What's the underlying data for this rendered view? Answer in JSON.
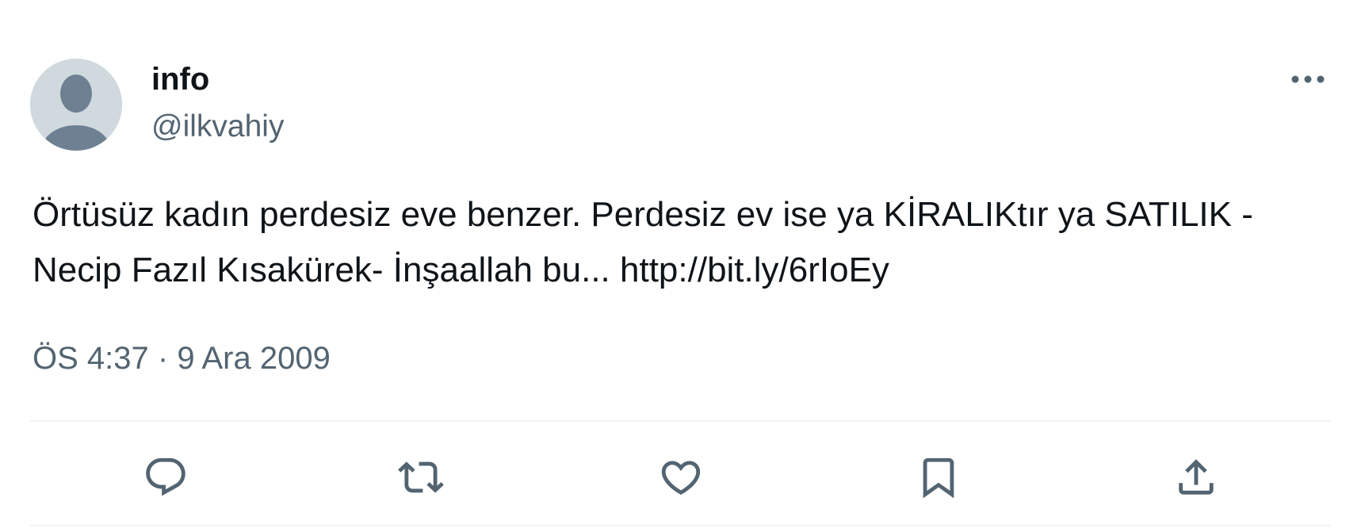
{
  "author": {
    "name": "info",
    "handle": "@ilkvahiy"
  },
  "tweet": {
    "text": "Örtüsüz kadın perdesiz eve benzer. Perdesiz ev ise ya KİRALIKtır ya SATILIK -Necip Fazıl Kısakürek- İnşaallah bu... ",
    "link": "http://bit.ly/6rIoEy",
    "time": "ÖS 4:37",
    "separator": " · ",
    "date": "9 Ara 2009"
  },
  "colors": {
    "text_primary": "#0f1419",
    "text_secondary": "#536471",
    "avatar_bg": "#cfd9de",
    "avatar_figure": "#6e8193",
    "divider": "#eff3f4"
  },
  "icons": {
    "more": "more-horizontal-icon",
    "reply": "reply-icon",
    "retweet": "retweet-icon",
    "like": "heart-icon",
    "bookmark": "bookmark-icon",
    "share": "share-icon"
  }
}
